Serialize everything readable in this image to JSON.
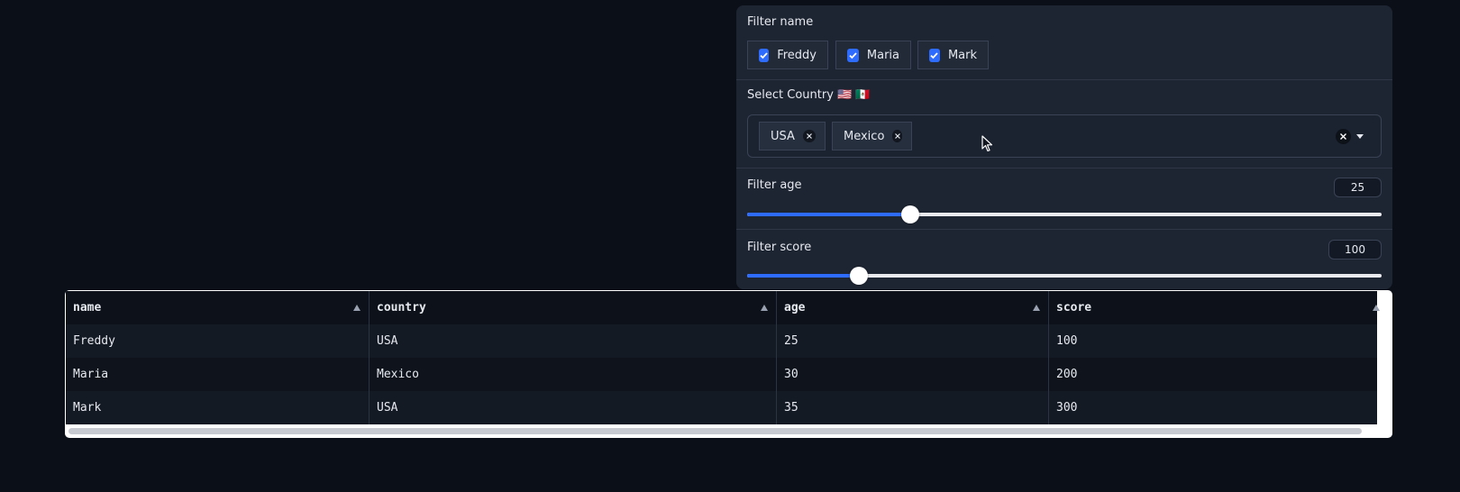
{
  "filters": {
    "name_filter": {
      "label": "Filter name",
      "options": [
        {
          "label": "Freddy",
          "checked": true
        },
        {
          "label": "Maria",
          "checked": true
        },
        {
          "label": "Mark",
          "checked": true
        }
      ]
    },
    "country_select": {
      "label": "Select Country 🇺🇸 🇲🇽",
      "selected": [
        "USA",
        "Mexico"
      ]
    },
    "age_slider": {
      "label": "Filter age",
      "value": "25",
      "fraction": 0.257
    },
    "score_slider": {
      "label": "Filter score",
      "value": "100",
      "fraction": 0.176
    }
  },
  "table": {
    "columns": [
      "name",
      "country",
      "age",
      "score"
    ],
    "rows": [
      [
        "Freddy",
        "USA",
        "25",
        "100"
      ],
      [
        "Maria",
        "Mexico",
        "30",
        "200"
      ],
      [
        "Mark",
        "USA",
        "35",
        "300"
      ]
    ]
  },
  "colors": {
    "accent": "#2e6bff",
    "panel": "#1e2532",
    "background": "#0b0f18"
  }
}
